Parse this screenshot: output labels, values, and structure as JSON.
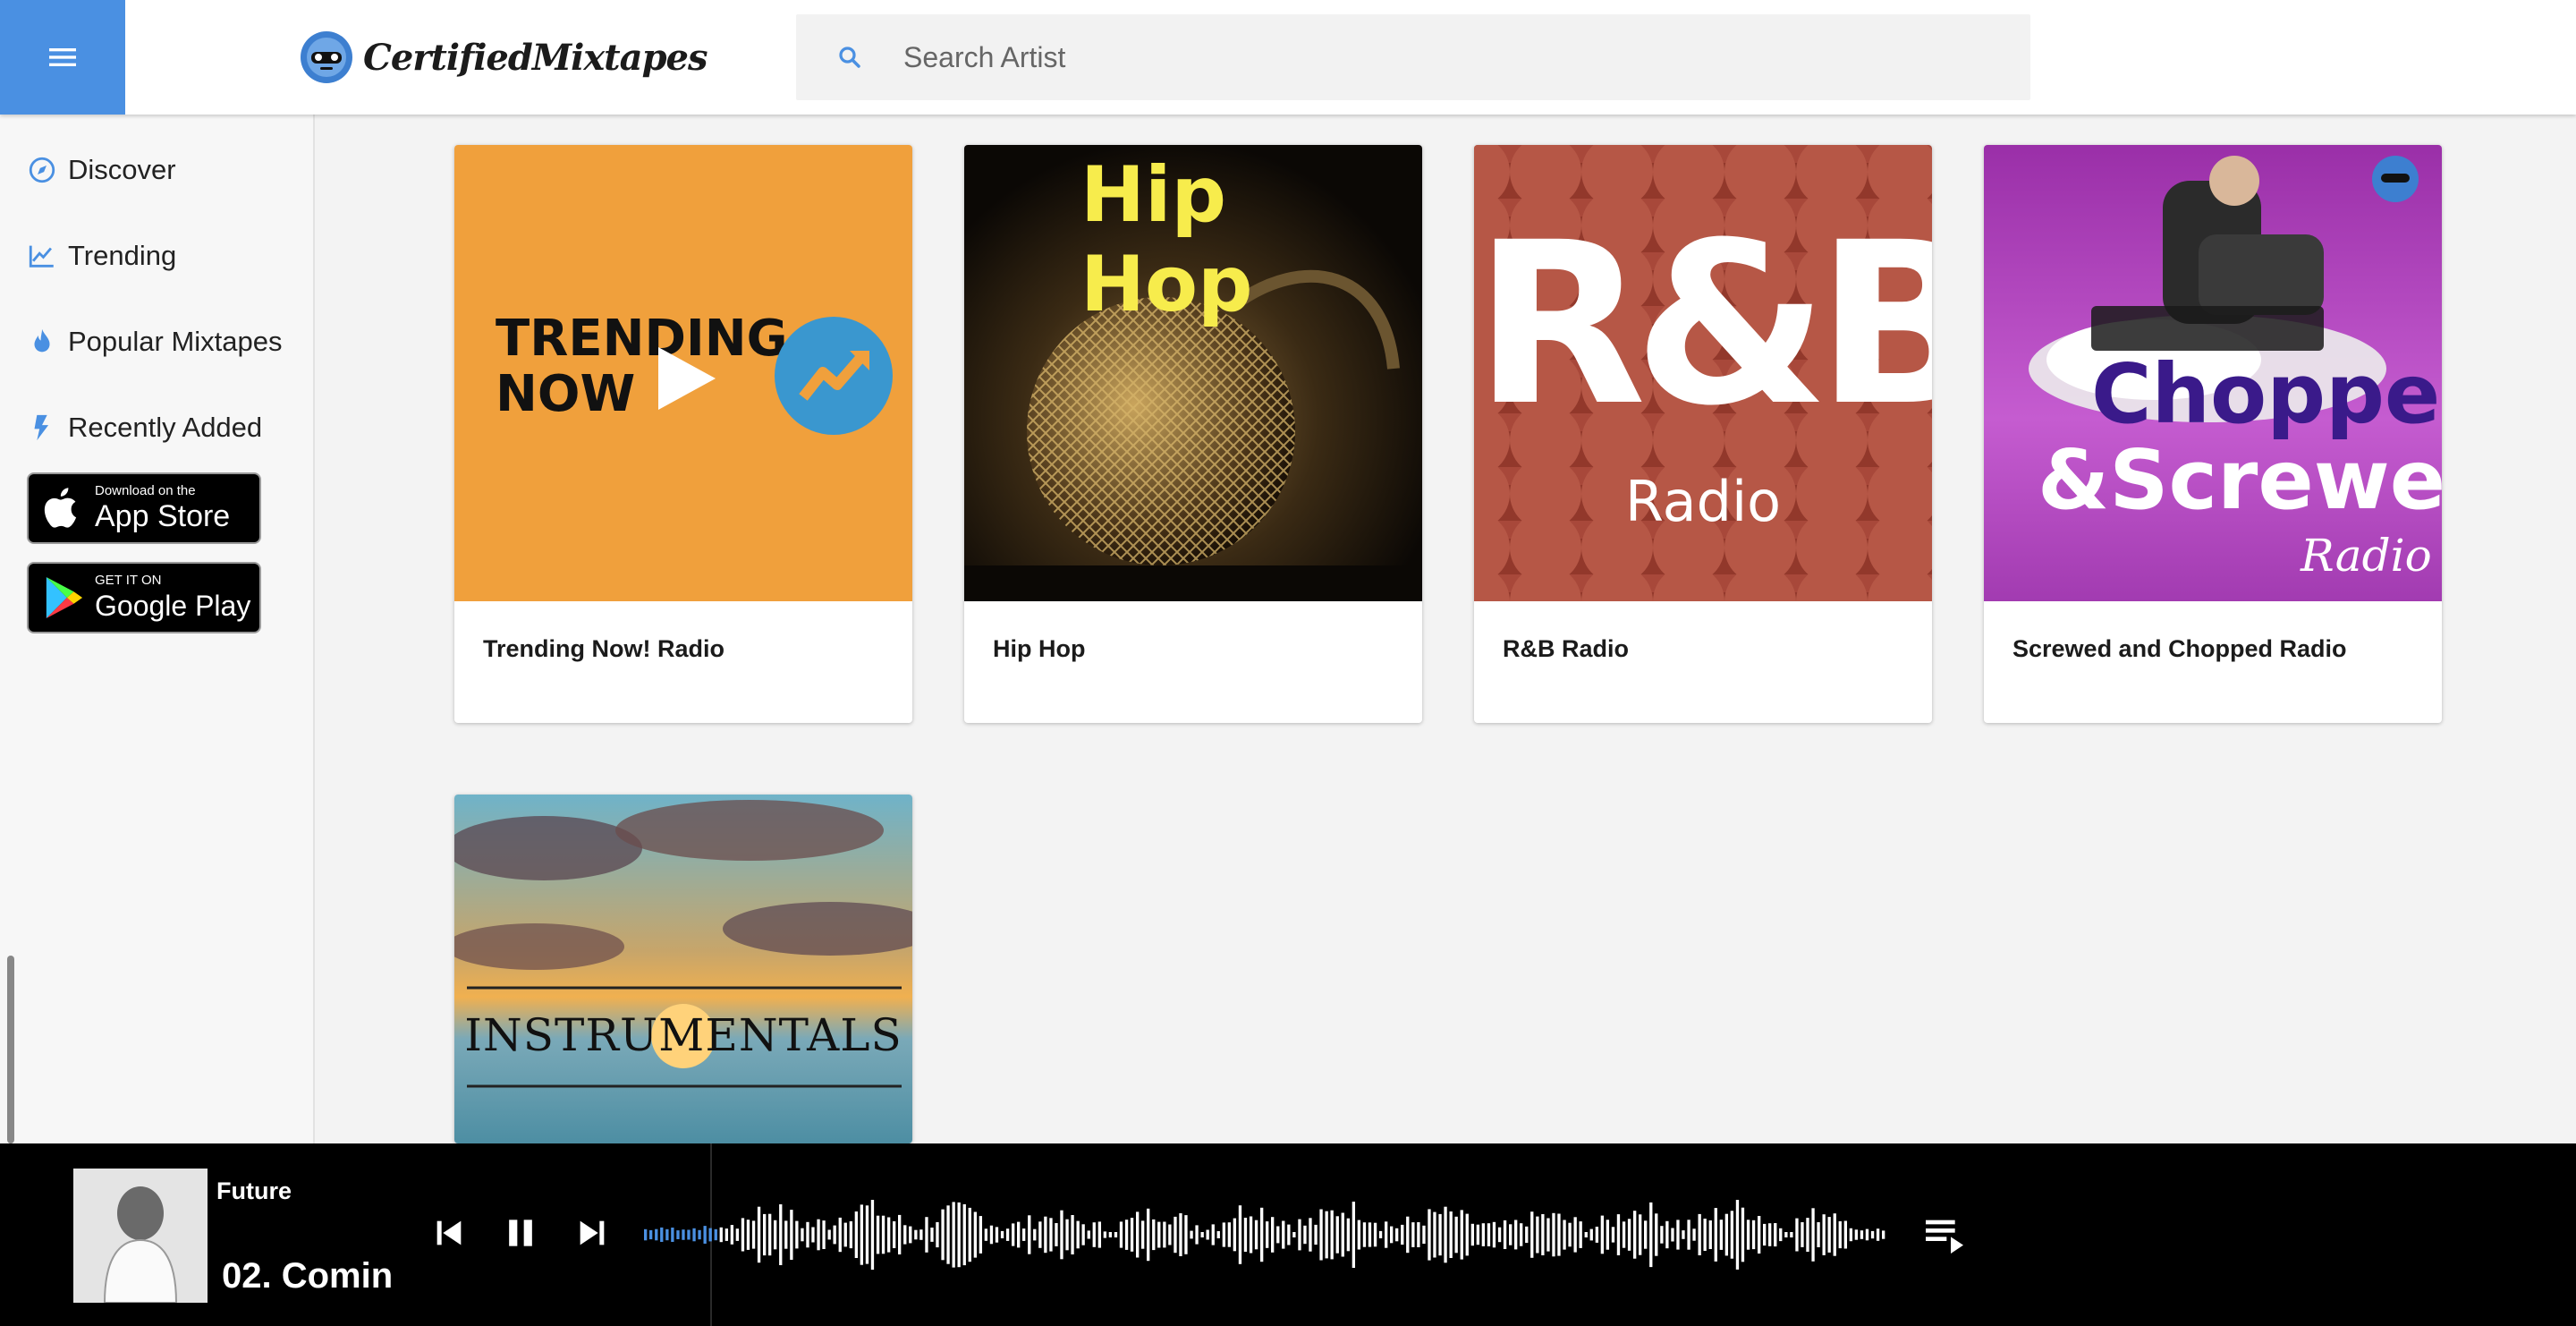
{
  "header": {
    "logo_text": "CertifiedMixtapes",
    "search_placeholder": "Search Artist"
  },
  "sidebar": {
    "items": [
      {
        "label": "Discover",
        "icon": "compass-icon"
      },
      {
        "label": "Trending",
        "icon": "trending-chart-icon"
      },
      {
        "label": "Popular Mixtapes",
        "icon": "flame-icon"
      },
      {
        "label": "Recently Added",
        "icon": "lightning-icon"
      }
    ],
    "app_store": {
      "small": "Download on the",
      "big": "App Store"
    },
    "google_play": {
      "small": "GET IT ON",
      "big": "Google Play"
    }
  },
  "cards": [
    {
      "title": "Trending Now! Radio",
      "art_text_1": "TRENDING",
      "art_text_2": "NOW"
    },
    {
      "title": "Hip Hop",
      "art_text_1": "Hip Hop"
    },
    {
      "title": "R&B Radio",
      "art_text_1": "R&B",
      "art_text_2": "Radio"
    },
    {
      "title": "Screwed and Chopped Radio",
      "art_text_1": "Chopped",
      "art_text_2": "&Screwed",
      "art_text_3": "Radio"
    },
    {
      "title": "",
      "art_text_1": "INSTRUMENTALS"
    }
  ],
  "player": {
    "artist": "Future",
    "track": "02. Comin"
  },
  "colors": {
    "accent": "#4a90e2",
    "trending_bg": "#f0a03c",
    "rnb_bg": "#a8483a",
    "chopped_bg": "#b24bc0"
  }
}
